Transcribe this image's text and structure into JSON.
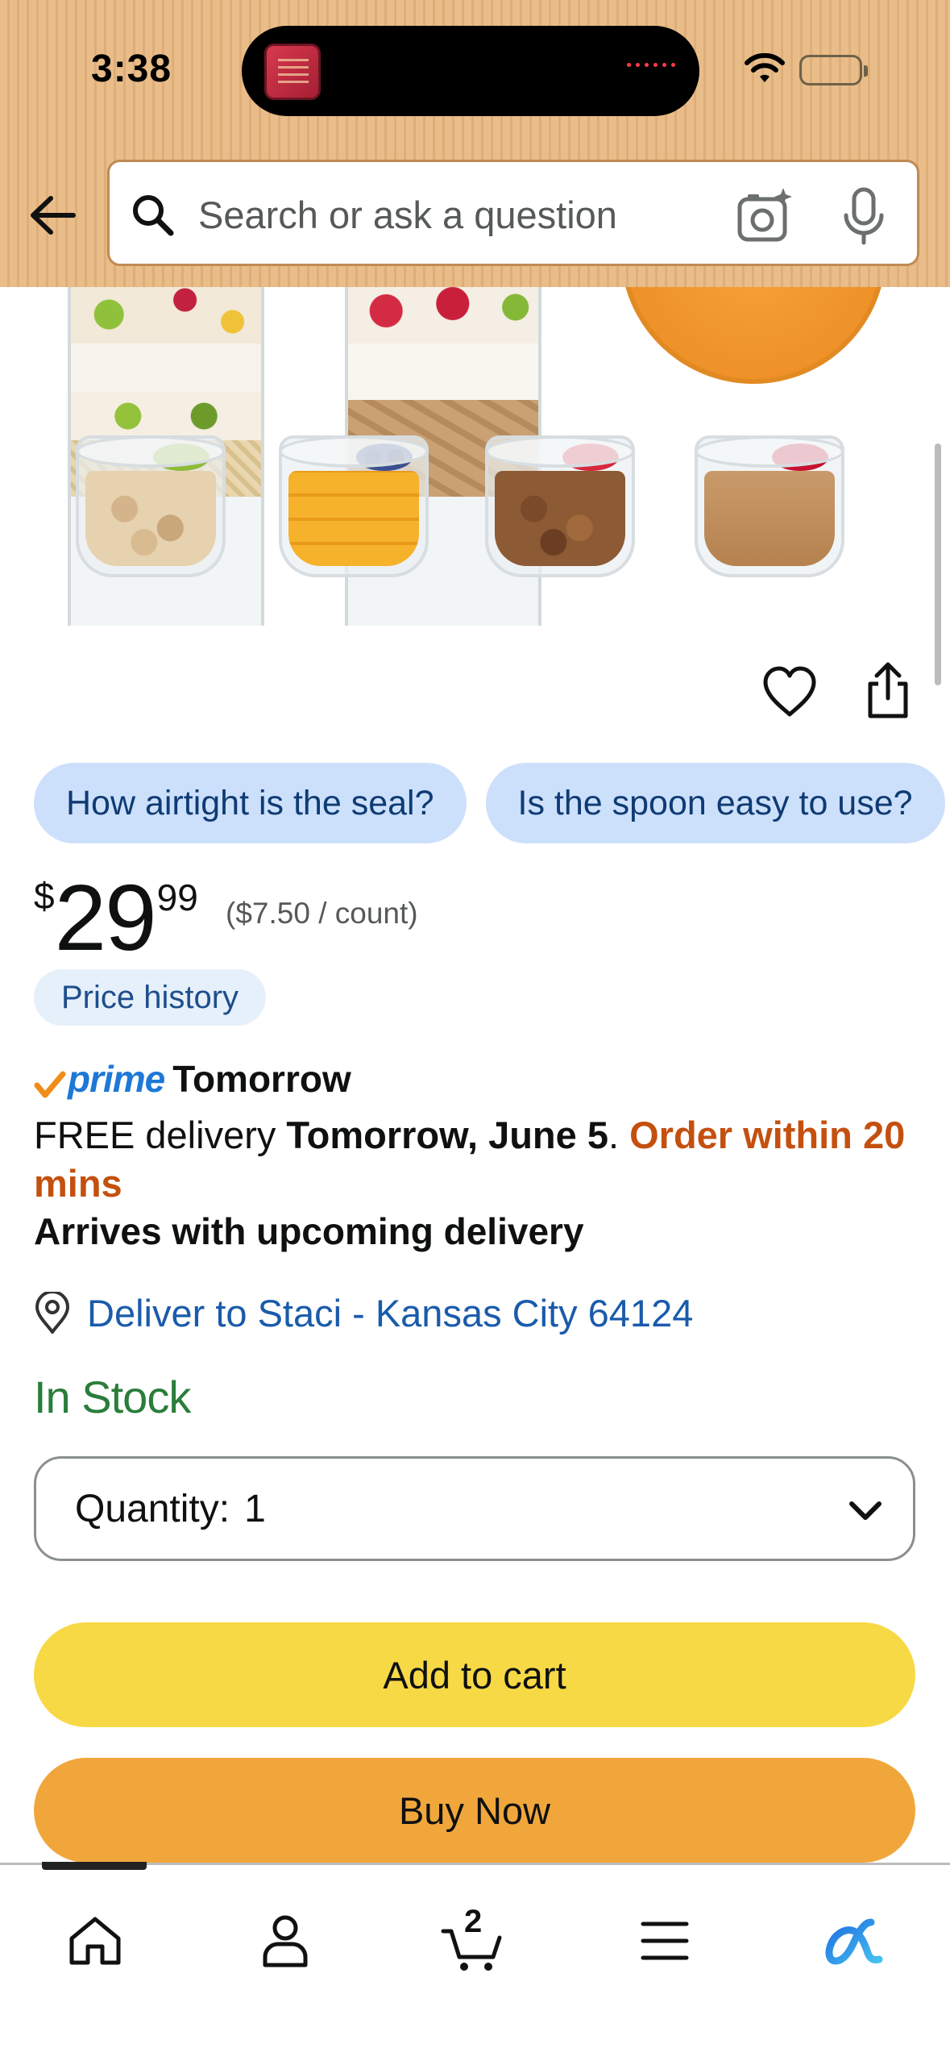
{
  "status_bar": {
    "time": "3:38"
  },
  "header": {
    "back_icon": "arrow-left-icon",
    "search": {
      "placeholder": "Search or ask a question",
      "value": ""
    },
    "camera_icon": "camera-sparkle-icon",
    "mic_icon": "microphone-icon"
  },
  "product_actions": {
    "wishlist_icon": "heart-icon",
    "share_icon": "share-icon"
  },
  "suggestion_chips": [
    {
      "label": "How airtight is the seal?"
    },
    {
      "label": "Is the spoon easy to use?"
    }
  ],
  "price": {
    "symbol": "$",
    "whole": "29",
    "fraction": "99",
    "unit_price": "($7.50 / count)"
  },
  "price_history": {
    "label": "Price history"
  },
  "delivery": {
    "prime_label": "prime",
    "prime_day": "Tomorrow",
    "free_prefix": "FREE delivery ",
    "date": "Tomorrow, June 5",
    "period": ". ",
    "urgency": "Order within 20 mins",
    "arrives": "Arrives with upcoming delivery",
    "deliver_to": "Deliver to Staci - Kansas City 64124"
  },
  "stock": {
    "status": "In Stock",
    "color": "#2a7d3a"
  },
  "quantity": {
    "label": "Quantity:",
    "value": "1"
  },
  "buttons": {
    "add_to_cart": "Add to cart",
    "buy_now": "Buy Now"
  },
  "bottom_nav": {
    "items": [
      {
        "name": "home",
        "icon": "home-icon"
      },
      {
        "name": "account",
        "icon": "person-icon"
      },
      {
        "name": "cart",
        "icon": "cart-icon",
        "badge": "2"
      },
      {
        "name": "menu",
        "icon": "hamburger-icon"
      },
      {
        "name": "rufus",
        "icon": "rufus-icon"
      }
    ]
  },
  "colors": {
    "header_bg": "#e9bd8a",
    "chip_bg": "#cce0fb",
    "add_to_cart": "#f7d946",
    "buy_now": "#f1a63c",
    "link": "#1a5bab",
    "urgent": "#c4500f",
    "prime": "#1e78d6"
  }
}
